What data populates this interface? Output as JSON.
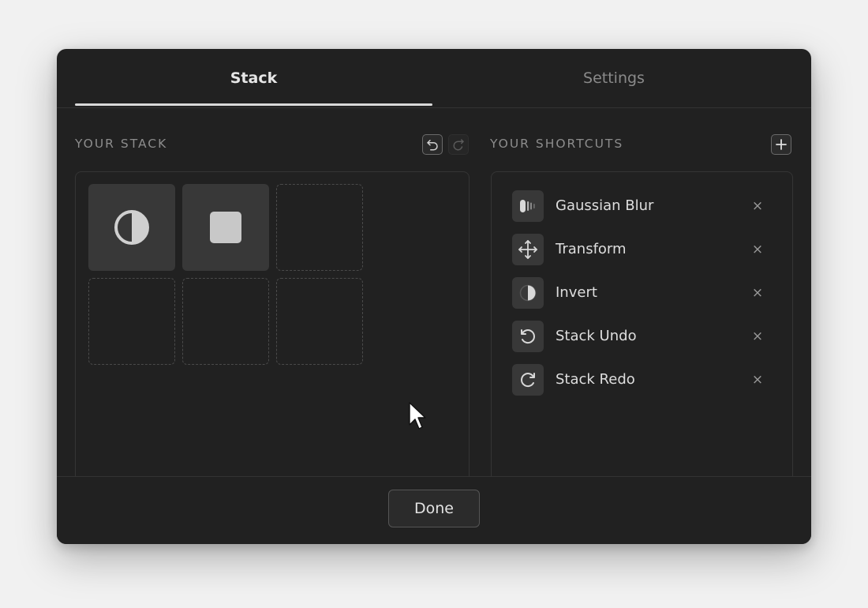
{
  "tabs": [
    {
      "label": "Stack",
      "active": true
    },
    {
      "label": "Settings",
      "active": false
    }
  ],
  "stack": {
    "title": "YOUR STACK",
    "undo_icon": "undo-icon",
    "redo_icon": "redo-icon",
    "slots": [
      {
        "icon": "invert-icon",
        "filled": true
      },
      {
        "icon": "square-icon",
        "filled": true
      },
      {
        "filled": false
      },
      {
        "filled": false
      },
      {
        "filled": false
      },
      {
        "filled": false
      }
    ]
  },
  "shortcuts": {
    "title": "YOUR SHORTCUTS",
    "add_icon": "plus-icon",
    "items": [
      {
        "label": "Gaussian Blur",
        "icon": "blur-icon",
        "remove": "×"
      },
      {
        "label": "Transform",
        "icon": "move-icon",
        "remove": "×"
      },
      {
        "label": "Invert",
        "icon": "invert-icon",
        "remove": "×"
      },
      {
        "label": "Stack Undo",
        "icon": "undo-icon",
        "remove": "×"
      },
      {
        "label": "Stack Redo",
        "icon": "redo-icon",
        "remove": "×"
      }
    ]
  },
  "footer": {
    "done_label": "Done"
  },
  "colors": {
    "dialog_bg": "#212121",
    "tile_bg": "#383838",
    "text": "#dedede",
    "muted": "#8c8c8c"
  }
}
